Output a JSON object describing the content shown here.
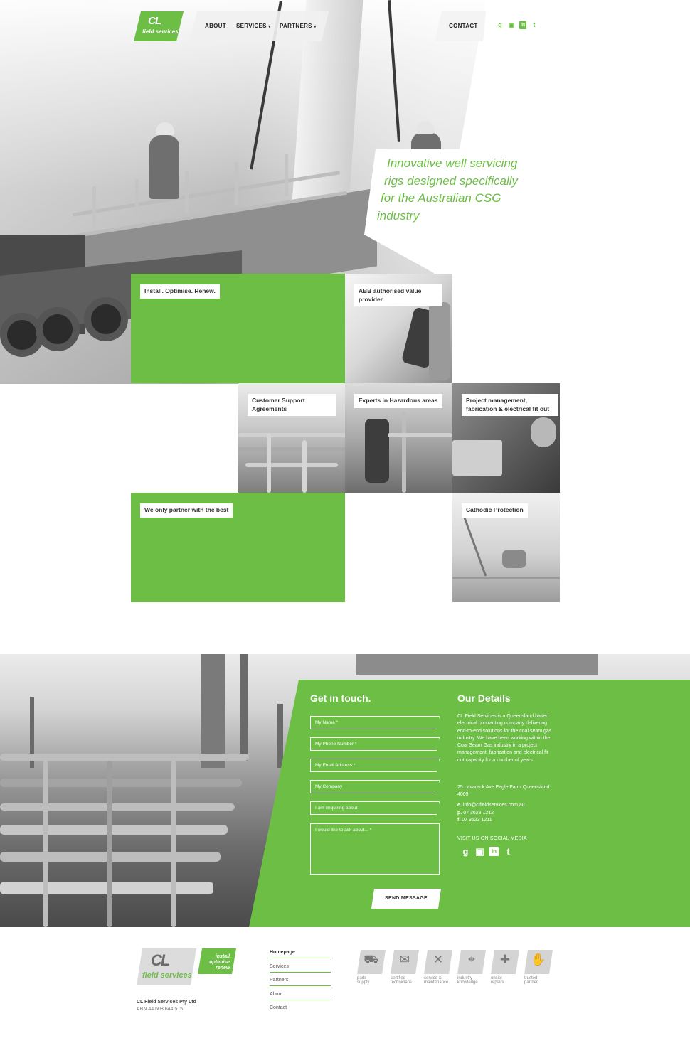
{
  "brand": {
    "logo_mark": "CL",
    "logo_text": "field services",
    "footer_tagline_1": "install.",
    "footer_tagline_2": "optimise.",
    "footer_tagline_3": "renew.",
    "accent_color": "#6cbe45"
  },
  "nav": {
    "about": "ABOUT",
    "services": "SERVICES",
    "partners": "PARTNERS",
    "contact": "CONTACT",
    "caret": "▾",
    "social_icons": [
      "google-plus-icon",
      "youtube-icon",
      "linkedin-icon",
      "twitter-icon"
    ],
    "social_glyphs": [
      "g",
      "▣",
      "in",
      "t"
    ]
  },
  "hero": {
    "tagline_lines": [
      "Innovative well servicing",
      "rigs designed specifically",
      "for the Australian CSG",
      "industry"
    ]
  },
  "tiles": {
    "install": "Install. Optimise. Renew.",
    "abb": "ABB authorised value provider",
    "customer_support": "Customer Support Agreements",
    "hazardous": "Experts in Hazardous areas",
    "project": "Project management, fabrication & electrical fit out",
    "partner": "We only partner with the best",
    "cathodic": "Cathodic Protection"
  },
  "contact_form": {
    "title": "Get in touch.",
    "fields": [
      "My Name *",
      "My Phone Number *",
      "My Email Address *",
      "My Company",
      "I am enquiring about"
    ],
    "message_placeholder": "I would like to ask about... *",
    "submit": "SEND MESSAGE"
  },
  "details": {
    "title": "Our Details",
    "text": "CL Field Services is a Queensland based electrical contracting company delivering end-to-end solutions for the coal seam gas industry. We have been working within the Coal Seam Gas industry in a project management, fabrication and electrical fit out capacity for a number of years.",
    "address": "25 Lavarack Ave Eagle Farm Queensland 4009",
    "email_label": "e.",
    "email": "info@clfieldservices.com.au",
    "phone_label": "p.",
    "phone": "07 3623 1212",
    "fax_label": "f.",
    "fax": "07 3623 1211",
    "social_label": "VISIT US ON SOCIAL MEDIA"
  },
  "footer": {
    "company": "CL Field Services Pty Ltd",
    "abn": "ABN 44 608 644 515",
    "links": [
      "Homepage",
      "Services",
      "Partners",
      "About",
      "Contact"
    ],
    "services": [
      {
        "icon": "parts-supply-icon",
        "glyph": "⛟",
        "line1": "parts",
        "line2": "supply"
      },
      {
        "icon": "certified-technicians-icon",
        "glyph": "✉",
        "line1": "certified",
        "line2": "technicians"
      },
      {
        "icon": "service-maintenance-icon",
        "glyph": "✕",
        "line1": "service &",
        "line2": "maintenance"
      },
      {
        "icon": "industry-knowledge-icon",
        "glyph": "⌖",
        "line1": "industry",
        "line2": "knowledge"
      },
      {
        "icon": "onsite-repairs-icon",
        "glyph": "✚",
        "line1": "onsite",
        "line2": "repairs"
      },
      {
        "icon": "trusted-partner-icon",
        "glyph": "✋",
        "line1": "trusted",
        "line2": "partner"
      }
    ]
  }
}
